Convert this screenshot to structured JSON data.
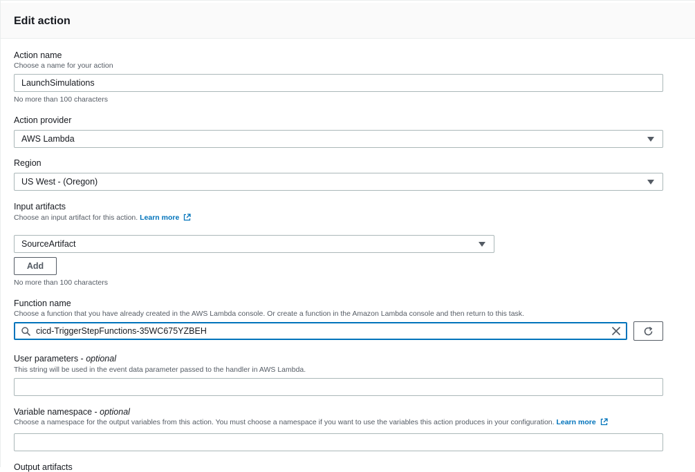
{
  "panel": {
    "title": "Edit action"
  },
  "action_name": {
    "label": "Action name",
    "description": "Choose a name for your action",
    "value": "LaunchSimulations",
    "constraint": "No more than 100 characters"
  },
  "action_provider": {
    "label": "Action provider",
    "selected": "AWS Lambda"
  },
  "region": {
    "label": "Region",
    "selected": "US West - (Oregon)"
  },
  "input_artifacts": {
    "label": "Input artifacts",
    "description": "Choose an input artifact for this action.",
    "learn_more": "Learn more",
    "selected": "SourceArtifact",
    "add_button": "Add",
    "constraint": "No more than 100 characters"
  },
  "function_name": {
    "label": "Function name",
    "description": "Choose a function that you have already created in the AWS Lambda console. Or create a function in the Amazon Lambda console and then return to this task.",
    "value": "cicd-TriggerStepFunctions-35WC675YZBEH"
  },
  "user_parameters": {
    "label": "User parameters - ",
    "optional": "optional",
    "description": "This string will be used in the event data parameter passed to the handler in AWS Lambda.",
    "value": ""
  },
  "variable_namespace": {
    "label": "Variable namespace - ",
    "optional": "optional",
    "description": "Choose a namespace for the output variables from this action. You must choose a namespace if you want to use the variables this action produces in your configuration.",
    "learn_more": "Learn more",
    "value": ""
  },
  "output_artifacts": {
    "label": "Output artifacts"
  },
  "icons": {
    "external_link": "external-link-icon",
    "dropdown": "caret-down-icon",
    "search": "search-icon",
    "clear": "close-icon",
    "refresh": "refresh-icon"
  },
  "colors": {
    "link": "#0073bb",
    "focus_border": "#0073bb",
    "text": "#16191f",
    "secondary_text": "#545b64",
    "border": "#aab7b8"
  }
}
